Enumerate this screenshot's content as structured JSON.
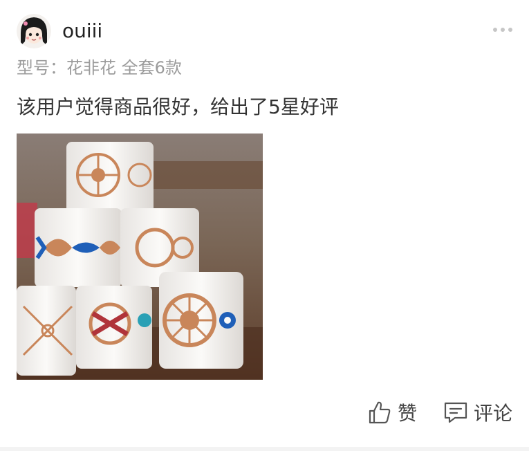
{
  "post": {
    "username": "ouiii",
    "model_text": "型号：花非花 全套6款",
    "review_text": "该用户觉得商品很好，给出了5星好评"
  },
  "actions": {
    "like_label": "赞",
    "comment_label": "评论"
  },
  "icons": {
    "more": "more-dots-icon",
    "like": "thumbs-up-icon",
    "comment": "comment-bubble-icon"
  },
  "colors": {
    "text_primary": "#333333",
    "text_secondary": "#9b9b9b",
    "icon_gray": "#555555",
    "tape_copper": "#c9865a",
    "tape_blue": "#1f5fb8"
  }
}
